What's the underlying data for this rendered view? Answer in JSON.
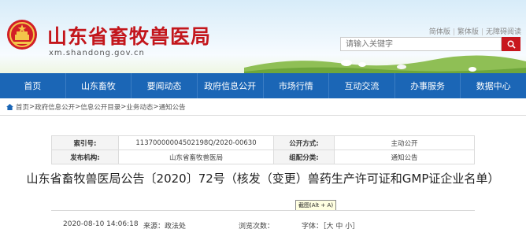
{
  "header": {
    "site_title": "山东省畜牧兽医局",
    "site_domain": "xm.shandong.gov.cn",
    "links": [
      "简体版",
      "繁体版",
      "无障碍阅读"
    ],
    "search_placeholder": "请输入关键字",
    "icons": {
      "emblem": "national-emblem-icon",
      "search": "search-icon"
    }
  },
  "nav": {
    "items": [
      "首页",
      "山东畜牧",
      "要闻动态",
      "政府信息公开",
      "市场行情",
      "互动交流",
      "办事服务",
      "数据中心"
    ]
  },
  "breadcrumb": {
    "items": [
      "首页",
      "政府信息公开",
      "信息公开目录",
      "业务动态",
      "通知公告"
    ],
    "separator": ">"
  },
  "info_table": {
    "rows": [
      [
        {
          "label": "索引号:",
          "value": "11370000004502198Q/2020-00630"
        },
        {
          "label": "公开方式:",
          "value": "主动公开"
        }
      ],
      [
        {
          "label": "发布机构:",
          "value": "山东省畜牧兽医局"
        },
        {
          "label": "组配分类:",
          "value": "通知公告"
        }
      ]
    ]
  },
  "article": {
    "title": "山东省畜牧兽医局公告〔2020〕72号（核发（变更）兽药生产许可证和GMP证企业名单）",
    "date": "2020-08-10 14:06:18",
    "source": "来源：政法处",
    "views": "浏览次数：",
    "font_size": "字体：［大 中 小］"
  },
  "tooltip": "截图(Alt + A)",
  "colors": {
    "title_red": "#c3161c",
    "nav_blue": "#1b66b6",
    "search_red": "#c8161d"
  }
}
